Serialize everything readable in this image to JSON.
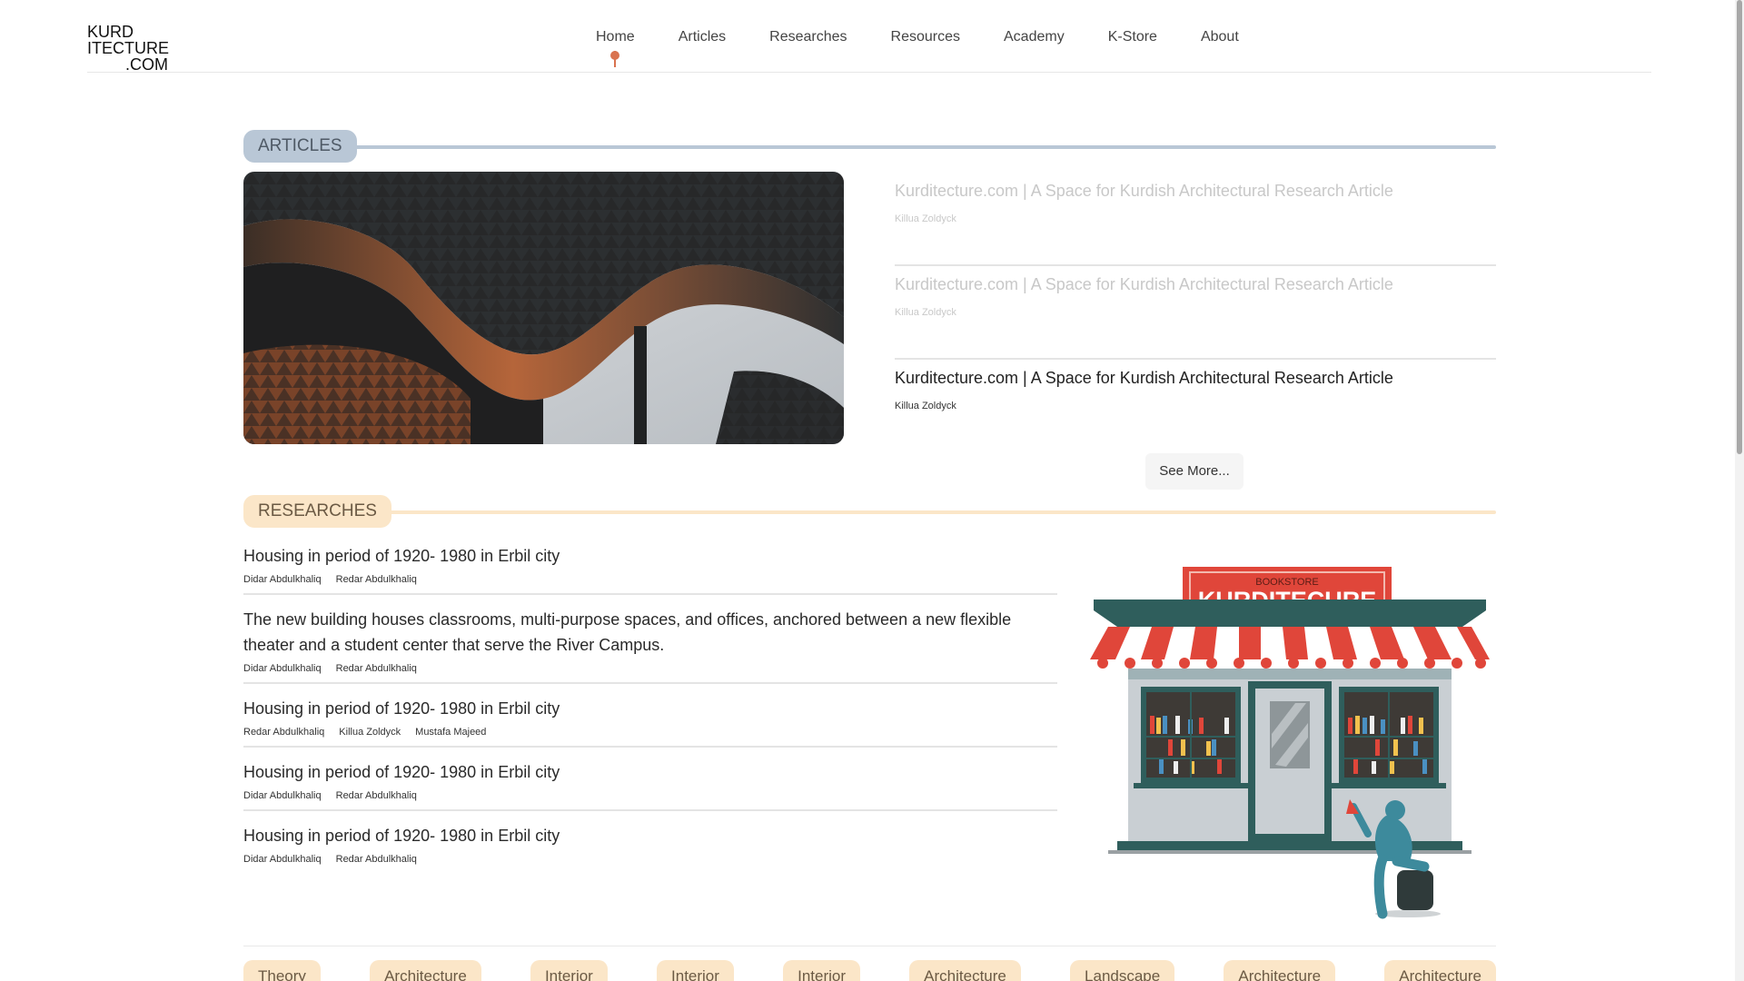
{
  "logo": {
    "line1": "KURD",
    "line2": "ITECTURE",
    "line3": ".COM"
  },
  "nav": {
    "items": [
      {
        "label": "Home",
        "active": true
      },
      {
        "label": "Articles"
      },
      {
        "label": "Researches"
      },
      {
        "label": "Resources"
      },
      {
        "label": "Academy"
      },
      {
        "label": "K-Store"
      },
      {
        "label": "About"
      }
    ]
  },
  "articles": {
    "heading": "ARTICLES",
    "items": [
      {
        "title": "Kurditecture.com | A Space for Kurdish Architectural Research Article",
        "author": "Killua Zoldyck"
      },
      {
        "title": "Kurditecture.com | A Space for Kurdish Architectural Research Article",
        "author": "Killua Zoldyck"
      },
      {
        "title": "Kurditecture.com | A Space for Kurdish Architectural Research Article",
        "author": "Killua Zoldyck"
      }
    ],
    "see_more": "See More..."
  },
  "researches": {
    "heading": "RESEARCHES",
    "items": [
      {
        "title": "Housing in period of 1920- 1980 in Erbil city",
        "authors": [
          "Didar Abdulkhaliq",
          "Redar Abdulkhaliq"
        ]
      },
      {
        "title": "The new building houses classrooms, multi-purpose spaces, and offices, anchored between a new flexible theater and a student center that serve the River Campus.",
        "authors": [
          "Didar Abdulkhaliq",
          "Redar Abdulkhaliq"
        ]
      },
      {
        "title": "Housing in period of 1920- 1980 in Erbil city",
        "authors": [
          "Redar Abdulkhaliq",
          "Killua Zoldyck",
          "Mustafa Majeed"
        ]
      },
      {
        "title": "Housing in period of 1920- 1980 in Erbil city",
        "authors": [
          "Didar Abdulkhaliq",
          "Redar Abdulkhaliq"
        ]
      },
      {
        "title": "Housing in period of 1920- 1980 in Erbil city",
        "authors": [
          "Didar Abdulkhaliq",
          "Redar Abdulkhaliq"
        ]
      }
    ]
  },
  "bookstore": {
    "small_sign": "BOOKSTORE",
    "big_sign": "KURDITECURE"
  },
  "tags": [
    "Theory",
    "Architecture",
    "Interior",
    "Interior",
    "Interior",
    "Architecture",
    "Landscape",
    "Architecture",
    "Architecture"
  ],
  "colors": {
    "accent": "#d9734f",
    "articles_band": "#b9c7d6",
    "researches_band": "#fbe6c8"
  }
}
